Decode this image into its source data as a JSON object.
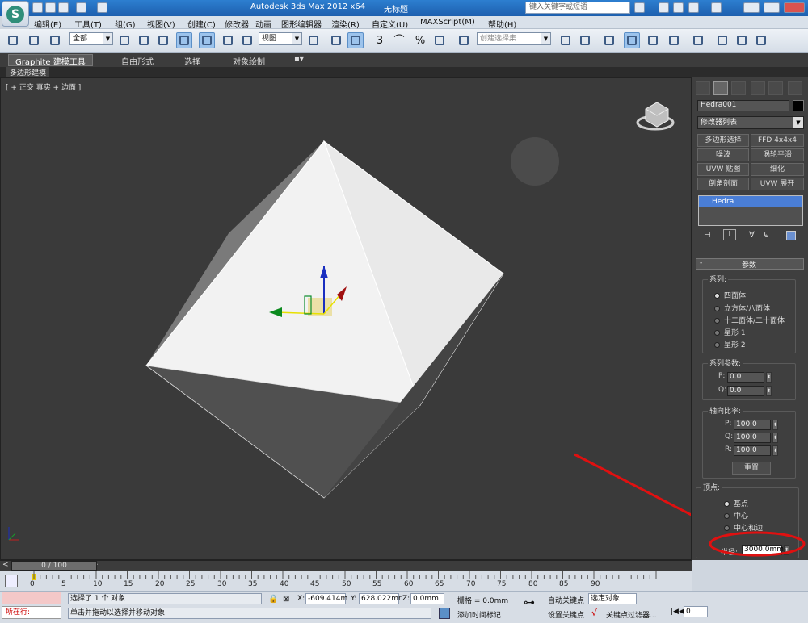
{
  "title_bar": {
    "app_title": "Autodesk 3ds Max  2012 x64",
    "doc_title": "无标题",
    "search_placeholder": "键入关键字或短语"
  },
  "menu": [
    "编辑(E)",
    "工具(T)",
    "组(G)",
    "视图(V)",
    "创建(C)",
    "修改器",
    "动画",
    "图形编辑器",
    "渲染(R)",
    "自定义(U)",
    "MAXScript(M)",
    "帮助(H)"
  ],
  "toolbar": {
    "selection_filter": "全部",
    "ref_coord": "视图",
    "named_selection": "创建选择集",
    "snap_3": "3",
    "snap_angle": "⌒",
    "snap_percent": "%"
  },
  "ribbon": {
    "tabs": [
      "Graphite 建模工具",
      "自由形式",
      "选择",
      "对象绘制"
    ],
    "sub_tab": "多边形建模"
  },
  "viewport": {
    "label": "[ + ] 正交 ] 真实 + 边面 ]",
    "label_parts": [
      "[ +",
      "正交",
      "真实 + 边面 ]"
    ]
  },
  "command_panel": {
    "object_name": "Hedra001",
    "modifier_list": "修改器列表",
    "modifier_buttons": [
      "多边形选择",
      "FFD 4x4x4",
      "噪波",
      "涡轮平滑",
      "UVW 贴图",
      "细化",
      "倒角剖面",
      "UVW 展开"
    ],
    "stack_item": "Hedra",
    "rollout_title": "参数",
    "family_group": "系列:",
    "family_options": [
      "四面体",
      "立方体/八面体",
      "十二面体/二十面体",
      "星形 1",
      "星形 2"
    ],
    "family_selected": 0,
    "family_params_group": "系列参数:",
    "family_params": [
      {
        "label": "P:",
        "value": "0.0"
      },
      {
        "label": "Q:",
        "value": "0.0"
      }
    ],
    "axis_group": "轴向比率:",
    "axis_params": [
      {
        "label": "P:",
        "value": "100.0"
      },
      {
        "label": "Q:",
        "value": "100.0"
      },
      {
        "label": "R:",
        "value": "100.0"
      }
    ],
    "reset_button": "重置",
    "vertex_group": "顶点:",
    "vertex_options": [
      "基点",
      "中心",
      "中心和边"
    ],
    "vertex_selected": 0,
    "radius_label": "半径:",
    "radius_value": "3000.0mm"
  },
  "timeline": {
    "slider": "0 / 100",
    "ticks": [
      "0",
      "5",
      "10",
      "15",
      "20",
      "25",
      "30",
      "35",
      "40",
      "45",
      "50",
      "55",
      "60",
      "65",
      "70",
      "75",
      "80",
      "85",
      "90"
    ]
  },
  "status": {
    "script_label": "所在行:",
    "message_1": "选择了 1 个 对象",
    "message_2": "单击并拖动以选择并移动对象",
    "x_label": "X:",
    "x_value": "-609.414m",
    "y_label": "Y:",
    "y_value": "628.022mr",
    "z_label": "Z:",
    "z_value": "0.0mm",
    "grid": "栅格 = 0.0mm",
    "add_time_tag": "添加时间标记",
    "auto_key": "自动关键点",
    "selected_obj": "选定对象",
    "set_key": "设置关键点",
    "key_filter": "关键点过滤器...",
    "frame": "0"
  },
  "colors": {
    "viewport_bg": "#3a3a3a",
    "panel_bg": "#3f3f3f",
    "title_blue": "#1d5fae",
    "annotation_red": "#e01010",
    "stack_selected": "#4a7ed6"
  }
}
